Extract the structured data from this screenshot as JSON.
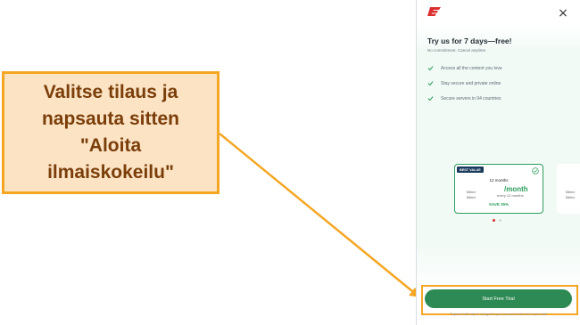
{
  "callout": {
    "lines": [
      "Valitse tilaus ja",
      "napsauta sitten",
      "\"Aloita",
      "ilmaiskokeilu\""
    ]
  },
  "colors": {
    "callout_bg": "#fbe3c4",
    "callout_border": "#f5a623",
    "callout_text": "#7a3e0a",
    "accent_green": "#2e8a55",
    "brand_red": "#d9302f"
  },
  "app": {
    "close_icon": "×",
    "title": "Try us for 7 days—free!",
    "subtitle": "No commitment. Cancel anytime.",
    "features": [
      {
        "icon": "check-icon",
        "label": "Access all the content you love"
      },
      {
        "icon": "check-icon",
        "label": "Stay secure and private online"
      },
      {
        "icon": "check-icon",
        "label": "Secure servers in 94 countries"
      }
    ],
    "plan": {
      "badge": "BEST VALUE",
      "months": "12 months",
      "price": "/month",
      "billed_1": "Billed",
      "every": "every 12 months",
      "billed_2": "Billed",
      "save": "SAVE 35%"
    },
    "next_plan": {
      "billed_1": "Billed",
      "billed_2": "Billed"
    },
    "cta_label": "Start Free Trial",
    "fineprint": "Payment will only be charged to your account at the end of your trial"
  }
}
